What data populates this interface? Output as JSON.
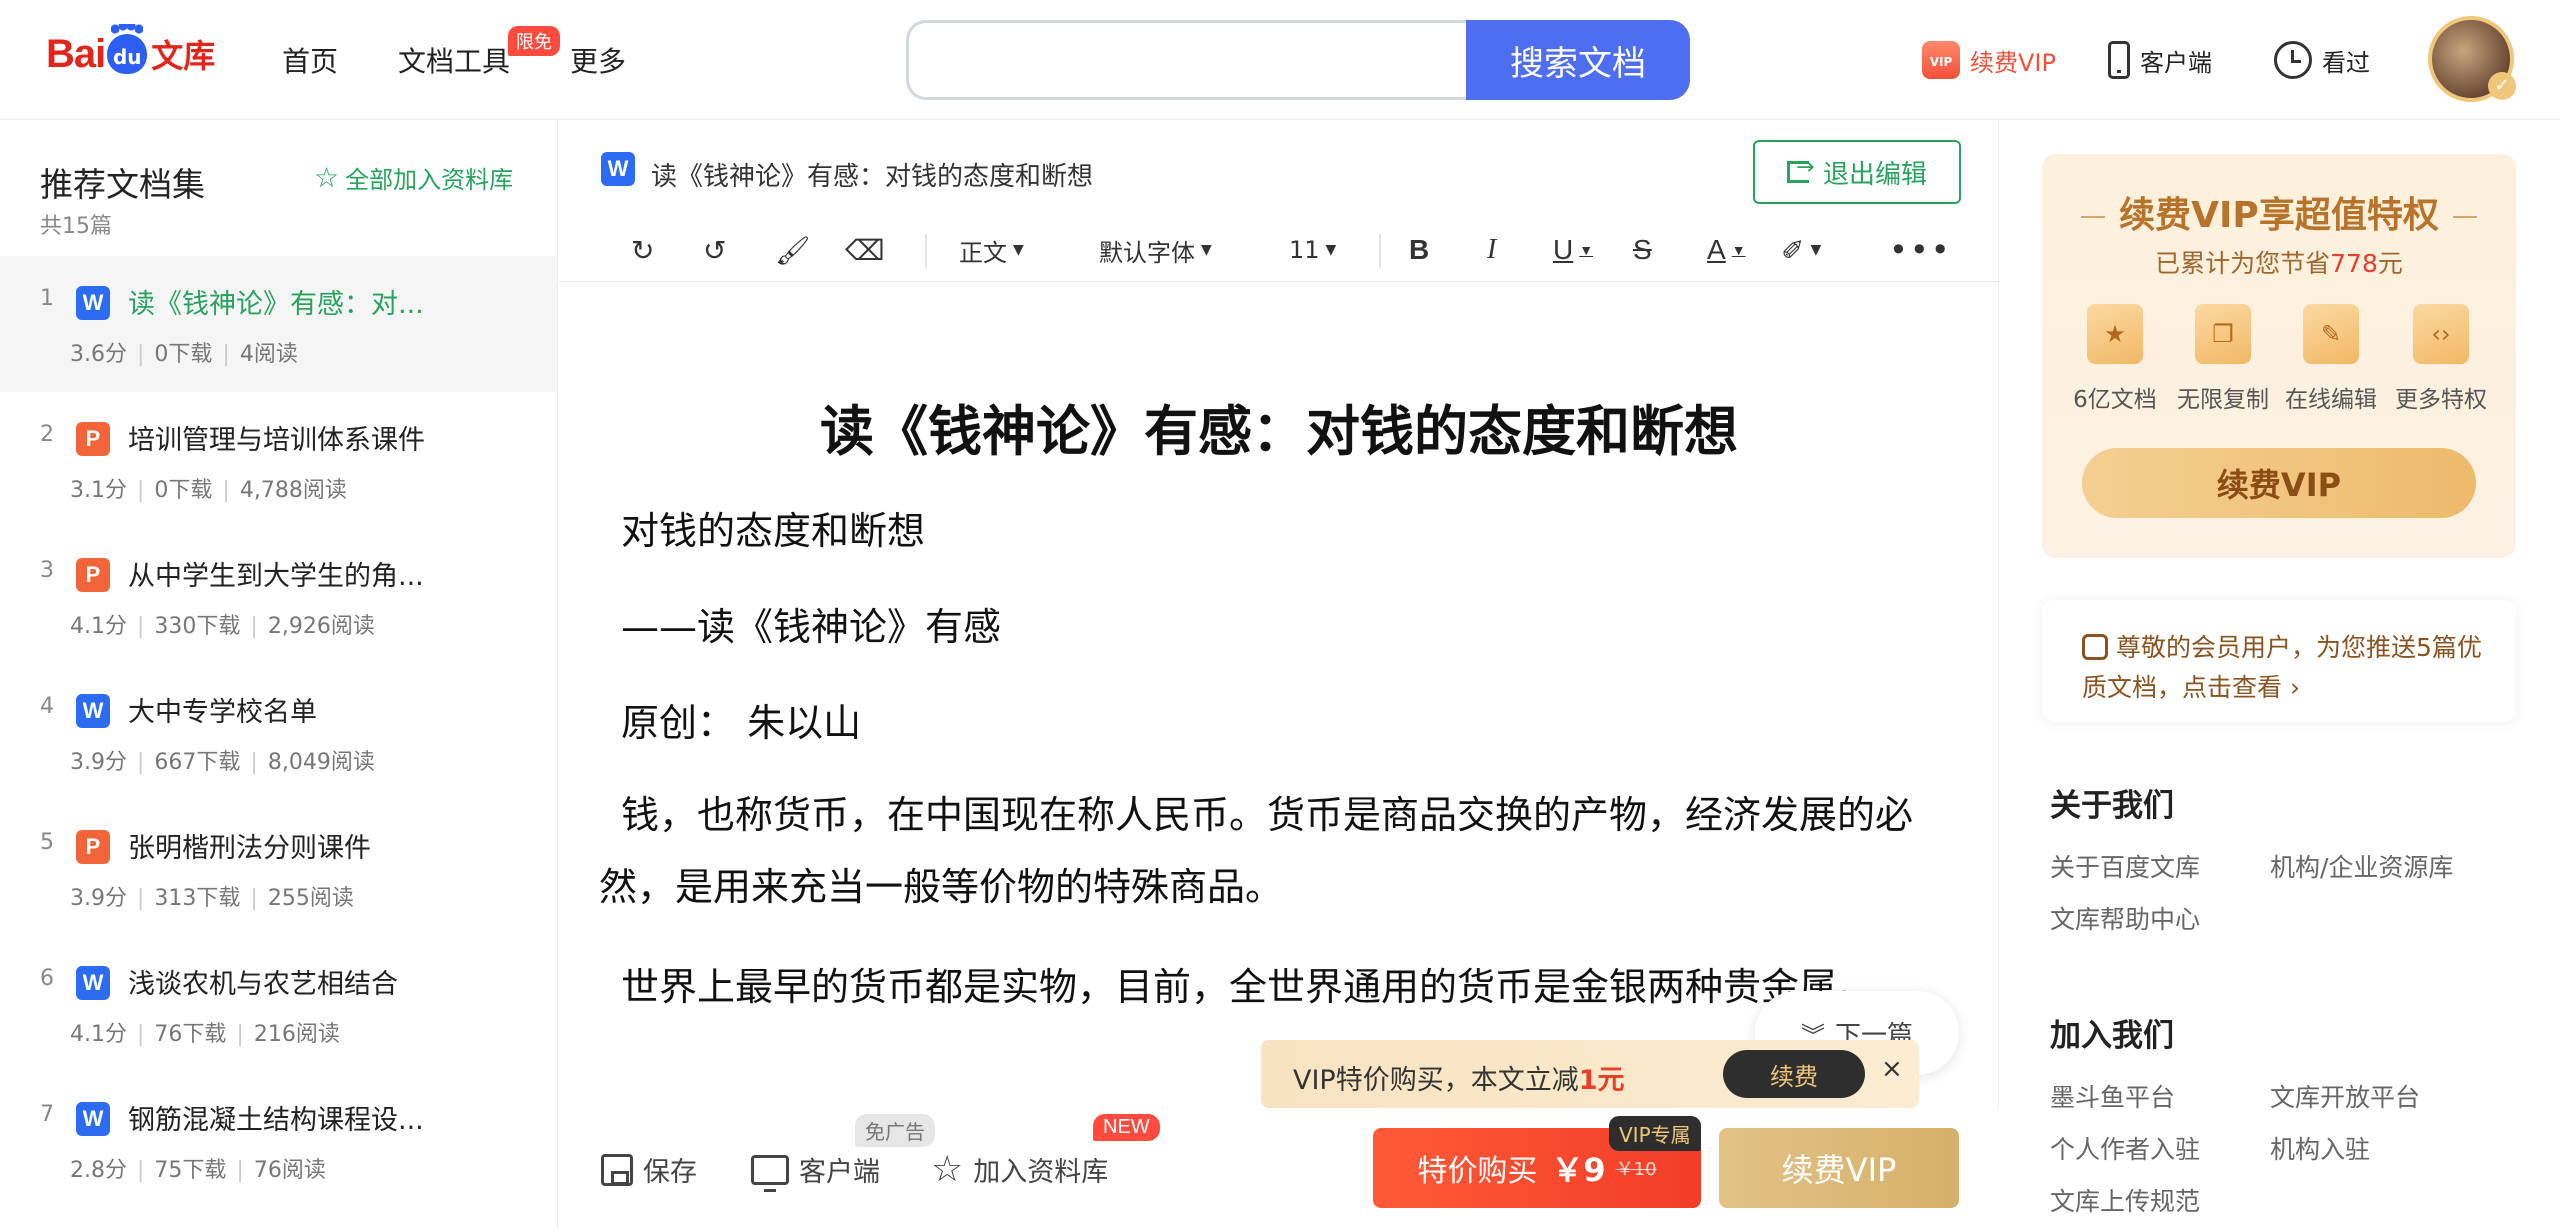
{
  "header": {
    "logo": {
      "bai": "Bai",
      "du": "du",
      "wenku": "文库"
    },
    "nav": {
      "home": "首页",
      "tools": "文档工具",
      "tools_badge": "限免",
      "more": "更多"
    },
    "search": {
      "value": "",
      "placeholder": "",
      "button": "搜索文档"
    },
    "right": {
      "vip": "续费VIP",
      "vip_icon_text": "VIP",
      "client": "客户端",
      "history": "看过"
    }
  },
  "sidebar": {
    "title": "推荐文档集",
    "count": "共15篇",
    "add_all": "全部加入资料库",
    "items": [
      {
        "num": "1",
        "type": "W",
        "name": "读《钱神论》有感：对...",
        "score": "3.6分",
        "downloads": "0下载",
        "reads": "4阅读",
        "active": true
      },
      {
        "num": "2",
        "type": "P",
        "name": "培训管理与培训体系课件",
        "score": "3.1分",
        "downloads": "0下载",
        "reads": "4,788阅读"
      },
      {
        "num": "3",
        "type": "P",
        "name": "从中学生到大学生的角...",
        "score": "4.1分",
        "downloads": "330下载",
        "reads": "2,926阅读"
      },
      {
        "num": "4",
        "type": "W",
        "name": "大中专学校名单",
        "score": "3.9分",
        "downloads": "667下载",
        "reads": "8,049阅读"
      },
      {
        "num": "5",
        "type": "P",
        "name": "张明楷刑法分则课件",
        "score": "3.9分",
        "downloads": "313下载",
        "reads": "255阅读"
      },
      {
        "num": "6",
        "type": "W",
        "name": "浅谈农机与农艺相结合",
        "score": "4.1分",
        "downloads": "76下载",
        "reads": "216阅读"
      },
      {
        "num": "7",
        "type": "W",
        "name": "钢筋混凝土结构课程设...",
        "score": "2.8分",
        "downloads": "75下载",
        "reads": "76阅读"
      }
    ]
  },
  "editor": {
    "doc_type": "W",
    "title": "读《钱神论》有感：对钱的态度和断想",
    "exit": "退出编辑",
    "toolbar": {
      "paragraph": "正文",
      "font": "默认字体",
      "size": "11",
      "bold": "B",
      "italic": "I",
      "underline": "U",
      "strike": "S",
      "color": "A",
      "more": "•••"
    },
    "doc": {
      "heading": "读《钱神论》有感：对钱的态度和断想",
      "paragraphs": [
        "对钱的态度和断想",
        "——读《钱神论》有感",
        "原创：  朱以山",
        "钱，也称货币，在中国现在称人民币。货币是商品交换的产物，经济发展的必然，是用来充当一般等价物的特殊商品。",
        "世界上最早的货币都是实物，目前，全世界通用的货币是金银两种贵金属。"
      ]
    },
    "next": "下一篇",
    "vip_strip": {
      "text": "VIP特价购买，本文立减",
      "amount": "1元",
      "renew": "续费",
      "close": "×"
    }
  },
  "bottom_bar": {
    "save": "保存",
    "client": "客户端",
    "client_tag": "免广告",
    "library": "加入资料库",
    "library_tag": "NEW",
    "buy": {
      "label": "特价购买",
      "price": "￥9",
      "old_price": "￥10",
      "tag": "VIP专属"
    },
    "renew_vip": "续费VIP"
  },
  "right_panel": {
    "vip_card": {
      "title": "续费VIP享超值特权",
      "sub_prefix": "已累计为您节省",
      "sub_amount": "778",
      "sub_suffix": "元",
      "features": [
        {
          "label": "6亿文档",
          "icon": "star-doc-icon",
          "glyph": "★"
        },
        {
          "label": "无限复制",
          "icon": "copy-icon",
          "glyph": "❐"
        },
        {
          "label": "在线编辑",
          "icon": "edit-icon",
          "glyph": "✎"
        },
        {
          "label": "更多特权",
          "icon": "code-icon",
          "glyph": "‹›"
        }
      ],
      "button": "续费VIP"
    },
    "notice": "尊敬的会员用户，为您推送5篇优质文档，点击查看",
    "notice_arrow": "›",
    "about": {
      "title": "关于我们",
      "links": [
        "关于百度文库",
        "机构/企业资源库",
        "文库帮助中心"
      ]
    },
    "join": {
      "title": "加入我们",
      "links": [
        "墨斗鱼平台",
        "文库开放平台",
        "个人作者入驻",
        "机构入驻",
        "文库上传规范"
      ]
    }
  },
  "colors": {
    "brand_red": "#e1251b",
    "search_blue": "#4e6ef2",
    "green": "#27a35d",
    "buy_red": "#f23d28",
    "vip_gold": "#d6b06a"
  }
}
